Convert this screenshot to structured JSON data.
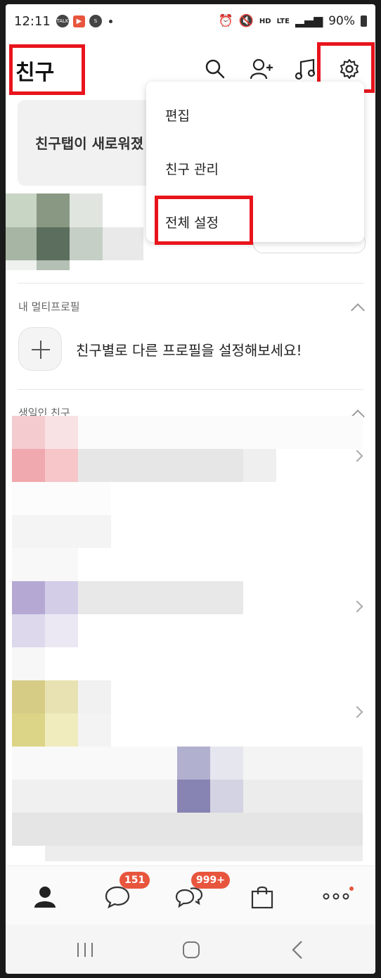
{
  "status_bar": {
    "time": "12:11",
    "left_icons": [
      "talk-icon",
      "notification-icon",
      "s-app-icon"
    ],
    "talk_label": "TALK",
    "network": "HD",
    "network_sub": "LTE",
    "battery": "90%"
  },
  "header": {
    "title": "친구",
    "icons": [
      "search-icon",
      "add-friend-icon",
      "music-icon",
      "settings-icon"
    ]
  },
  "banner": {
    "text": "친구탭이 새로워졌"
  },
  "dropdown": {
    "items": [
      "편집",
      "친구 관리",
      "전체 설정"
    ]
  },
  "multi_profile": {
    "section_label": "내 멀티프로필",
    "prompt": "친구별로 다른 프로필을 설정해보세요!"
  },
  "birthday": {
    "section_label": "생일인 친구"
  },
  "bottom_nav": {
    "items": [
      "friends-icon",
      "chat-icon",
      "openchat-icon",
      "shopping-icon",
      "more-icon"
    ],
    "chat_badge": "151",
    "openchat_badge": "999+"
  },
  "colors": {
    "accent": "#e8553d",
    "highlight": "#e8141c"
  }
}
